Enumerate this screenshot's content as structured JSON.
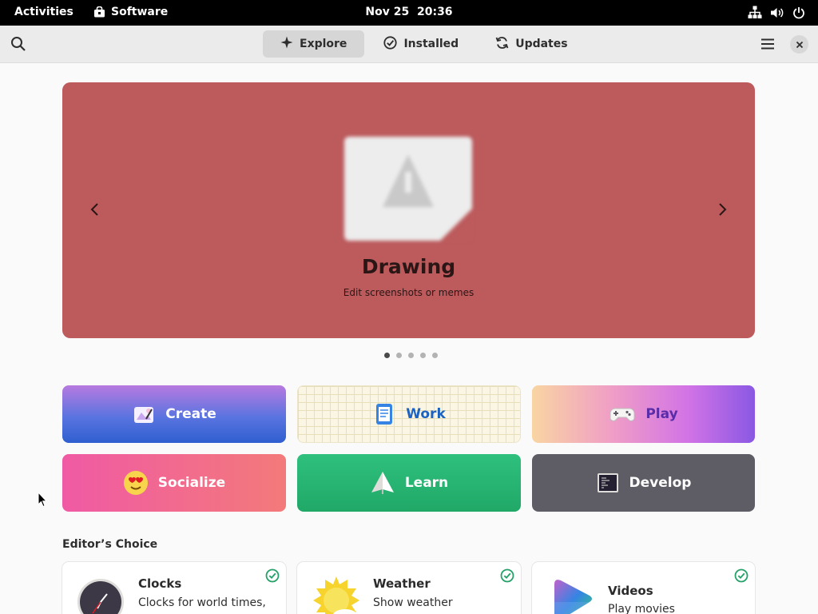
{
  "topbar": {
    "activities": "Activities",
    "app_name": "Software",
    "clock": "Nov 25  20:36",
    "status_icons": [
      "network-icon",
      "volume-icon",
      "power-icon"
    ]
  },
  "header": {
    "tabs": [
      {
        "label": "Explore",
        "icon": "explore-icon",
        "active": true
      },
      {
        "label": "Installed",
        "icon": "installed-icon",
        "active": false
      },
      {
        "label": "Updates",
        "icon": "updates-icon",
        "active": false
      }
    ],
    "icons": [
      "search-icon",
      "hamburger-menu-icon",
      "close-icon"
    ]
  },
  "featured": {
    "title": "Drawing",
    "subtitle": "Edit screenshots or memes",
    "background_color": "#bc5a5c",
    "page_count": 5,
    "active_page": 1
  },
  "categories": [
    {
      "label": "Create",
      "icon": "create-icon"
    },
    {
      "label": "Work",
      "icon": "work-icon"
    },
    {
      "label": "Play",
      "icon": "gamepad-icon"
    },
    {
      "label": "Socialize",
      "icon": "emoji-icon"
    },
    {
      "label": "Learn",
      "icon": "learn-icon"
    },
    {
      "label": "Develop",
      "icon": "terminal-icon"
    }
  ],
  "editors_choice": {
    "title": "Editor’s Choice",
    "apps": [
      {
        "name": "Clocks",
        "description": "Clocks for world times,",
        "icon": "clock-icon",
        "installed": true
      },
      {
        "name": "Weather",
        "description": "Show weather",
        "icon": "weather-icon",
        "installed": true
      },
      {
        "name": "Videos",
        "description": "Play movies",
        "icon": "videos-icon",
        "installed": true
      }
    ]
  },
  "colors": {
    "accent_check": "#26a269",
    "topbar": "#000000",
    "headerbar": "#ebebeb"
  }
}
